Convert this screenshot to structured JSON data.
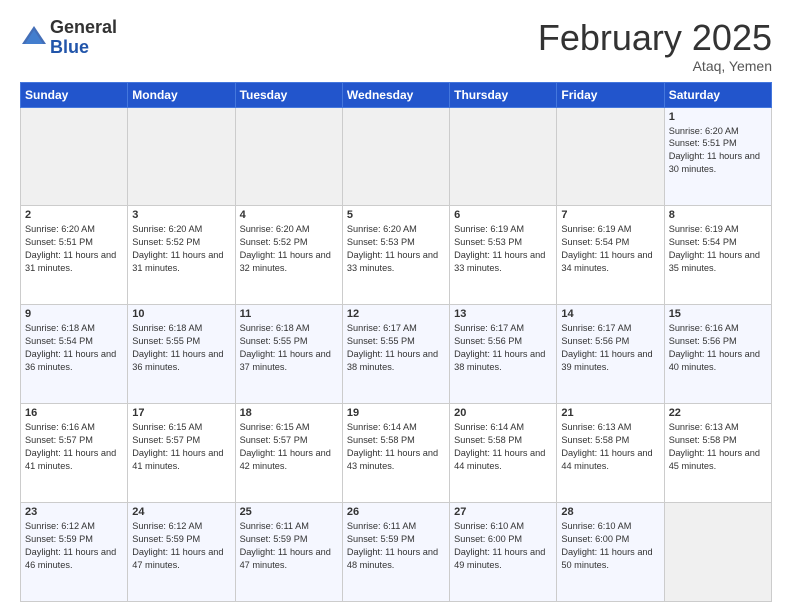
{
  "header": {
    "logo_general": "General",
    "logo_blue": "Blue",
    "month_title": "February 2025",
    "location": "Ataq, Yemen"
  },
  "weekdays": [
    "Sunday",
    "Monday",
    "Tuesday",
    "Wednesday",
    "Thursday",
    "Friday",
    "Saturday"
  ],
  "weeks": [
    [
      {
        "day": "",
        "sunrise": "",
        "sunset": "",
        "daylight": ""
      },
      {
        "day": "",
        "sunrise": "",
        "sunset": "",
        "daylight": ""
      },
      {
        "day": "",
        "sunrise": "",
        "sunset": "",
        "daylight": ""
      },
      {
        "day": "",
        "sunrise": "",
        "sunset": "",
        "daylight": ""
      },
      {
        "day": "",
        "sunrise": "",
        "sunset": "",
        "daylight": ""
      },
      {
        "day": "",
        "sunrise": "",
        "sunset": "",
        "daylight": ""
      },
      {
        "day": "1",
        "sunrise": "Sunrise: 6:20 AM",
        "sunset": "Sunset: 5:51 PM",
        "daylight": "Daylight: 11 hours and 30 minutes."
      }
    ],
    [
      {
        "day": "2",
        "sunrise": "Sunrise: 6:20 AM",
        "sunset": "Sunset: 5:51 PM",
        "daylight": "Daylight: 11 hours and 31 minutes."
      },
      {
        "day": "3",
        "sunrise": "Sunrise: 6:20 AM",
        "sunset": "Sunset: 5:52 PM",
        "daylight": "Daylight: 11 hours and 31 minutes."
      },
      {
        "day": "4",
        "sunrise": "Sunrise: 6:20 AM",
        "sunset": "Sunset: 5:52 PM",
        "daylight": "Daylight: 11 hours and 32 minutes."
      },
      {
        "day": "5",
        "sunrise": "Sunrise: 6:20 AM",
        "sunset": "Sunset: 5:53 PM",
        "daylight": "Daylight: 11 hours and 33 minutes."
      },
      {
        "day": "6",
        "sunrise": "Sunrise: 6:19 AM",
        "sunset": "Sunset: 5:53 PM",
        "daylight": "Daylight: 11 hours and 33 minutes."
      },
      {
        "day": "7",
        "sunrise": "Sunrise: 6:19 AM",
        "sunset": "Sunset: 5:54 PM",
        "daylight": "Daylight: 11 hours and 34 minutes."
      },
      {
        "day": "8",
        "sunrise": "Sunrise: 6:19 AM",
        "sunset": "Sunset: 5:54 PM",
        "daylight": "Daylight: 11 hours and 35 minutes."
      }
    ],
    [
      {
        "day": "9",
        "sunrise": "Sunrise: 6:18 AM",
        "sunset": "Sunset: 5:54 PM",
        "daylight": "Daylight: 11 hours and 36 minutes."
      },
      {
        "day": "10",
        "sunrise": "Sunrise: 6:18 AM",
        "sunset": "Sunset: 5:55 PM",
        "daylight": "Daylight: 11 hours and 36 minutes."
      },
      {
        "day": "11",
        "sunrise": "Sunrise: 6:18 AM",
        "sunset": "Sunset: 5:55 PM",
        "daylight": "Daylight: 11 hours and 37 minutes."
      },
      {
        "day": "12",
        "sunrise": "Sunrise: 6:17 AM",
        "sunset": "Sunset: 5:55 PM",
        "daylight": "Daylight: 11 hours and 38 minutes."
      },
      {
        "day": "13",
        "sunrise": "Sunrise: 6:17 AM",
        "sunset": "Sunset: 5:56 PM",
        "daylight": "Daylight: 11 hours and 38 minutes."
      },
      {
        "day": "14",
        "sunrise": "Sunrise: 6:17 AM",
        "sunset": "Sunset: 5:56 PM",
        "daylight": "Daylight: 11 hours and 39 minutes."
      },
      {
        "day": "15",
        "sunrise": "Sunrise: 6:16 AM",
        "sunset": "Sunset: 5:56 PM",
        "daylight": "Daylight: 11 hours and 40 minutes."
      }
    ],
    [
      {
        "day": "16",
        "sunrise": "Sunrise: 6:16 AM",
        "sunset": "Sunset: 5:57 PM",
        "daylight": "Daylight: 11 hours and 41 minutes."
      },
      {
        "day": "17",
        "sunrise": "Sunrise: 6:15 AM",
        "sunset": "Sunset: 5:57 PM",
        "daylight": "Daylight: 11 hours and 41 minutes."
      },
      {
        "day": "18",
        "sunrise": "Sunrise: 6:15 AM",
        "sunset": "Sunset: 5:57 PM",
        "daylight": "Daylight: 11 hours and 42 minutes."
      },
      {
        "day": "19",
        "sunrise": "Sunrise: 6:14 AM",
        "sunset": "Sunset: 5:58 PM",
        "daylight": "Daylight: 11 hours and 43 minutes."
      },
      {
        "day": "20",
        "sunrise": "Sunrise: 6:14 AM",
        "sunset": "Sunset: 5:58 PM",
        "daylight": "Daylight: 11 hours and 44 minutes."
      },
      {
        "day": "21",
        "sunrise": "Sunrise: 6:13 AM",
        "sunset": "Sunset: 5:58 PM",
        "daylight": "Daylight: 11 hours and 44 minutes."
      },
      {
        "day": "22",
        "sunrise": "Sunrise: 6:13 AM",
        "sunset": "Sunset: 5:58 PM",
        "daylight": "Daylight: 11 hours and 45 minutes."
      }
    ],
    [
      {
        "day": "23",
        "sunrise": "Sunrise: 6:12 AM",
        "sunset": "Sunset: 5:59 PM",
        "daylight": "Daylight: 11 hours and 46 minutes."
      },
      {
        "day": "24",
        "sunrise": "Sunrise: 6:12 AM",
        "sunset": "Sunset: 5:59 PM",
        "daylight": "Daylight: 11 hours and 47 minutes."
      },
      {
        "day": "25",
        "sunrise": "Sunrise: 6:11 AM",
        "sunset": "Sunset: 5:59 PM",
        "daylight": "Daylight: 11 hours and 47 minutes."
      },
      {
        "day": "26",
        "sunrise": "Sunrise: 6:11 AM",
        "sunset": "Sunset: 5:59 PM",
        "daylight": "Daylight: 11 hours and 48 minutes."
      },
      {
        "day": "27",
        "sunrise": "Sunrise: 6:10 AM",
        "sunset": "Sunset: 6:00 PM",
        "daylight": "Daylight: 11 hours and 49 minutes."
      },
      {
        "day": "28",
        "sunrise": "Sunrise: 6:10 AM",
        "sunset": "Sunset: 6:00 PM",
        "daylight": "Daylight: 11 hours and 50 minutes."
      },
      {
        "day": "",
        "sunrise": "",
        "sunset": "",
        "daylight": ""
      }
    ]
  ]
}
